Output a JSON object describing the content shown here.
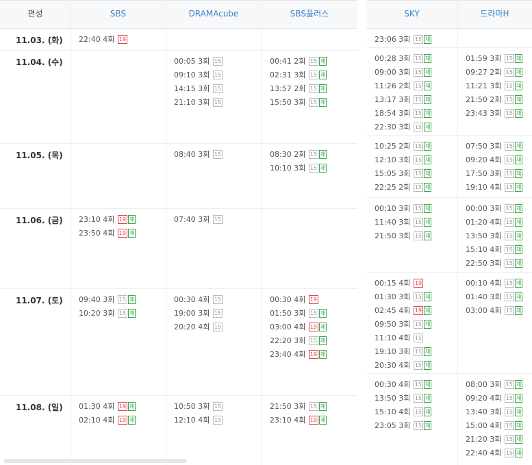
{
  "left_table": {
    "headers": [
      "편성",
      "SBS",
      "DRAMAcube",
      "SBS플러스"
    ],
    "rows": [
      {
        "date": "11.03. (화)",
        "cols": [
          [
            {
              "time": "22:40",
              "ep": "4회",
              "badges": [
                "19"
              ]
            }
          ],
          [],
          []
        ]
      },
      {
        "date": "11.04. (수)",
        "cols": [
          [],
          [
            {
              "time": "00:05",
              "ep": "3회",
              "badges": [
                "15"
              ]
            },
            {
              "time": "09:10",
              "ep": "3회",
              "badges": [
                "15"
              ]
            },
            {
              "time": "14:15",
              "ep": "3회",
              "badges": [
                "15"
              ]
            },
            {
              "time": "21:10",
              "ep": "3회",
              "badges": [
                "15"
              ]
            }
          ],
          [
            {
              "time": "00:41",
              "ep": "2회",
              "badges": [
                "15",
                "재"
              ]
            },
            {
              "time": "02:31",
              "ep": "3회",
              "badges": [
                "15",
                "재"
              ]
            },
            {
              "time": "13:57",
              "ep": "2회",
              "badges": [
                "15",
                "재"
              ]
            },
            {
              "time": "15:50",
              "ep": "3회",
              "badges": [
                "15",
                "재"
              ]
            }
          ]
        ]
      },
      {
        "date": "11.05. (목)",
        "cols": [
          [],
          [
            {
              "time": "08:40",
              "ep": "3회",
              "badges": [
                "15"
              ]
            }
          ],
          [
            {
              "time": "08:30",
              "ep": "2회",
              "badges": [
                "15",
                "재"
              ]
            },
            {
              "time": "10:10",
              "ep": "3회",
              "badges": [
                "15",
                "재"
              ]
            }
          ]
        ]
      },
      {
        "date": "11.06. (금)",
        "cols": [
          [
            {
              "time": "23:10",
              "ep": "4회",
              "badges": [
                "19",
                "재"
              ]
            },
            {
              "time": "23:50",
              "ep": "4회",
              "badges": [
                "19",
                "재"
              ]
            }
          ],
          [
            {
              "time": "07:40",
              "ep": "3회",
              "badges": [
                "15"
              ]
            }
          ],
          []
        ]
      },
      {
        "date": "11.07. (토)",
        "cols": [
          [
            {
              "time": "09:40",
              "ep": "3회",
              "badges": [
                "15",
                "재"
              ]
            },
            {
              "time": "10:20",
              "ep": "3회",
              "badges": [
                "15",
                "재"
              ]
            }
          ],
          [
            {
              "time": "00:30",
              "ep": "4회",
              "badges": [
                "15"
              ]
            },
            {
              "time": "19:00",
              "ep": "3회",
              "badges": [
                "15"
              ]
            },
            {
              "time": "20:20",
              "ep": "4회",
              "badges": [
                "15"
              ]
            }
          ],
          [
            {
              "time": "00:30",
              "ep": "4회",
              "badges": [
                "19"
              ]
            },
            {
              "time": "01:50",
              "ep": "3회",
              "badges": [
                "15",
                "재"
              ]
            },
            {
              "time": "03:00",
              "ep": "4회",
              "badges": [
                "19",
                "재"
              ]
            },
            {
              "time": "22:20",
              "ep": "3회",
              "badges": [
                "15",
                "재"
              ]
            },
            {
              "time": "23:40",
              "ep": "4회",
              "badges": [
                "19",
                "재"
              ]
            }
          ]
        ]
      },
      {
        "date": "11.08. (일)",
        "cols": [
          [
            {
              "time": "01:30",
              "ep": "4회",
              "badges": [
                "19",
                "재"
              ]
            },
            {
              "time": "02:10",
              "ep": "4회",
              "badges": [
                "19",
                "재"
              ]
            }
          ],
          [
            {
              "time": "10:50",
              "ep": "3회",
              "badges": [
                "15"
              ]
            },
            {
              "time": "12:10",
              "ep": "4회",
              "badges": [
                "15"
              ]
            }
          ],
          [
            {
              "time": "21:50",
              "ep": "3회",
              "badges": [
                "15",
                "재"
              ]
            },
            {
              "time": "23:10",
              "ep": "4회",
              "badges": [
                "19",
                "재"
              ]
            }
          ]
        ]
      }
    ]
  },
  "right_table": {
    "headers": [
      "SKY",
      "드라마H"
    ],
    "rows": [
      {
        "cols": [
          [
            {
              "time": "23:06",
              "ep": "3회",
              "badges": [
                "15",
                "재"
              ]
            }
          ],
          []
        ]
      },
      {
        "cols": [
          [
            {
              "time": "00:28",
              "ep": "3회",
              "badges": [
                "15",
                "재"
              ]
            },
            {
              "time": "09:00",
              "ep": "3회",
              "badges": [
                "15",
                "재"
              ]
            },
            {
              "time": "11:26",
              "ep": "2회",
              "badges": [
                "15",
                "재"
              ]
            },
            {
              "time": "13:17",
              "ep": "3회",
              "badges": [
                "15",
                "재"
              ]
            },
            {
              "time": "18:54",
              "ep": "3회",
              "badges": [
                "15",
                "재"
              ]
            },
            {
              "time": "22:30",
              "ep": "3회",
              "badges": [
                "15",
                "재"
              ]
            }
          ],
          [
            {
              "time": "01:59",
              "ep": "3회",
              "badges": [
                "15",
                "재"
              ]
            },
            {
              "time": "09:27",
              "ep": "2회",
              "badges": [
                "15",
                "재"
              ]
            },
            {
              "time": "11:21",
              "ep": "3회",
              "badges": [
                "15",
                "재"
              ]
            },
            {
              "time": "21:50",
              "ep": "2회",
              "badges": [
                "15",
                "재"
              ]
            },
            {
              "time": "23:43",
              "ep": "3회",
              "badges": [
                "15",
                "재"
              ]
            }
          ]
        ]
      },
      {
        "cols": [
          [
            {
              "time": "10:25",
              "ep": "2회",
              "badges": [
                "15",
                "재"
              ]
            },
            {
              "time": "12:10",
              "ep": "3회",
              "badges": [
                "15",
                "재"
              ]
            },
            {
              "time": "15:05",
              "ep": "3회",
              "badges": [
                "15",
                "재"
              ]
            },
            {
              "time": "22:25",
              "ep": "2회",
              "badges": [
                "15",
                "재"
              ]
            }
          ],
          [
            {
              "time": "07:50",
              "ep": "3회",
              "badges": [
                "15",
                "재"
              ]
            },
            {
              "time": "09:20",
              "ep": "4회",
              "badges": [
                "15",
                "재"
              ]
            },
            {
              "time": "17:50",
              "ep": "3회",
              "badges": [
                "15",
                "재"
              ]
            },
            {
              "time": "19:10",
              "ep": "4회",
              "badges": [
                "15",
                "재"
              ]
            }
          ]
        ]
      },
      {
        "cols": [
          [
            {
              "time": "00:10",
              "ep": "3회",
              "badges": [
                "15",
                "재"
              ]
            },
            {
              "time": "11:40",
              "ep": "3회",
              "badges": [
                "15",
                "재"
              ]
            },
            {
              "time": "21:50",
              "ep": "3회",
              "badges": [
                "15",
                "재"
              ]
            }
          ],
          [
            {
              "time": "00:00",
              "ep": "3회",
              "badges": [
                "15",
                "재"
              ]
            },
            {
              "time": "01:20",
              "ep": "4회",
              "badges": [
                "15",
                "재"
              ]
            },
            {
              "time": "13:50",
              "ep": "3회",
              "badges": [
                "15",
                "재"
              ]
            },
            {
              "time": "15:10",
              "ep": "4회",
              "badges": [
                "15",
                "재"
              ]
            },
            {
              "time": "22:50",
              "ep": "3회",
              "badges": [
                "15",
                "재"
              ]
            }
          ]
        ]
      },
      {
        "cols": [
          [
            {
              "time": "00:15",
              "ep": "4회",
              "badges": [
                "19"
              ]
            },
            {
              "time": "01:30",
              "ep": "3회",
              "badges": [
                "15",
                "재"
              ]
            },
            {
              "time": "02:45",
              "ep": "4회",
              "badges": [
                "19",
                "재"
              ]
            },
            {
              "time": "09:50",
              "ep": "3회",
              "badges": [
                "15",
                "재"
              ]
            },
            {
              "time": "11:10",
              "ep": "4회",
              "badges": [
                "15"
              ]
            },
            {
              "time": "19:10",
              "ep": "3회",
              "badges": [
                "15",
                "재"
              ]
            },
            {
              "time": "20:30",
              "ep": "4회",
              "badges": [
                "15",
                "재"
              ]
            }
          ],
          [
            {
              "time": "00:10",
              "ep": "4회",
              "badges": [
                "15",
                "재"
              ]
            },
            {
              "time": "01:40",
              "ep": "3회",
              "badges": [
                "15",
                "재"
              ]
            },
            {
              "time": "03:00",
              "ep": "4회",
              "badges": [
                "15",
                "재"
              ]
            }
          ]
        ]
      },
      {
        "cols": [
          [
            {
              "time": "00:30",
              "ep": "4회",
              "badges": [
                "15",
                "재"
              ]
            },
            {
              "time": "13:50",
              "ep": "3회",
              "badges": [
                "15",
                "재"
              ]
            },
            {
              "time": "15:10",
              "ep": "4회",
              "badges": [
                "15",
                "재"
              ]
            },
            {
              "time": "23:05",
              "ep": "3회",
              "badges": [
                "15",
                "재"
              ]
            }
          ],
          [
            {
              "time": "08:00",
              "ep": "3회",
              "badges": [
                "15",
                "재"
              ]
            },
            {
              "time": "09:20",
              "ep": "4회",
              "badges": [
                "15",
                "재"
              ]
            },
            {
              "time": "13:40",
              "ep": "3회",
              "badges": [
                "15",
                "재"
              ]
            },
            {
              "time": "15:00",
              "ep": "4회",
              "badges": [
                "15",
                "재"
              ]
            },
            {
              "time": "21:20",
              "ep": "3회",
              "badges": [
                "15",
                "재"
              ]
            },
            {
              "time": "22:40",
              "ep": "4회",
              "badges": [
                "15",
                "재"
              ]
            }
          ]
        ]
      }
    ]
  },
  "colors": {
    "header_link": "#3a86c8",
    "badge_19": "#e0454b",
    "badge_rerun": "#3aa84a",
    "badge_15": "#9a9a9a",
    "grid": "#eceef1"
  }
}
